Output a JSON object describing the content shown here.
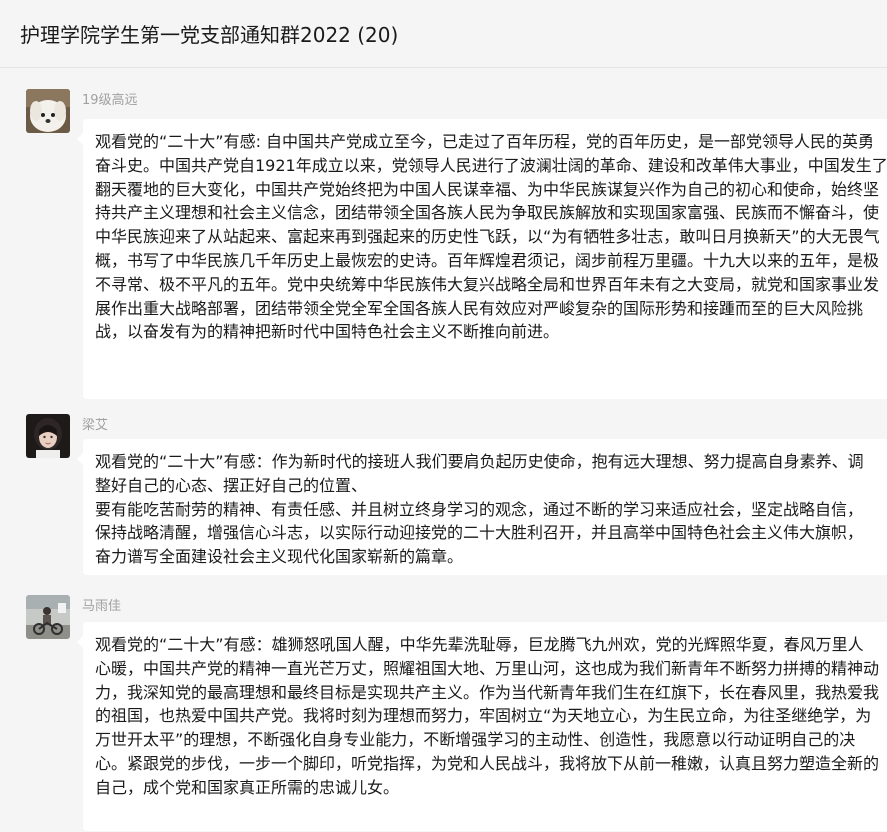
{
  "header": {
    "title": "护理学院学生第一党支部通知群2022 (20)"
  },
  "messages": [
    {
      "sender": "19级高远",
      "avatar": "white-dog-avatar",
      "text": "观看党的“二十大”有感: 自中国共产党成立至今，已走过了百年历程，党的百年历史，是一部党领导人民的英勇奋斗史。中国共产党自1921年成立以来，党领导人民进行了波澜壮阔的革命、建设和改革伟大事业，中国发生了翻天覆地的巨大变化，中国共产党始终把为中国人民谋幸福、为中华民族谋复兴作为自己的初心和使命，始终坚持共产主义理想和社会主义信念，团结带领全国各族人民为争取民族解放和实现国家富强、民族而不懈奋斗，使中华民族迎来了从站起来、富起来再到强起来的历史性飞跃，以“为有牺牲多壮志，敢叫日月换新天”的大无畏气概，书写了中华民族几千年历史上最恢宏的史诗。百年辉煌君须记，阔步前程万里疆。十九大以来的五年，是极不寻常、极不平凡的五年。党中央统筹中华民族伟大复兴战略全局和世界百年未有之大变局，就党和国家事业发展作出重大战略部署，团结带领全党全军全国各族人民有效应对严峻复杂的国际形势和接踵而至的巨大风险挑战，以奋发有为的精神把新时代中国特色社会主义不断推向前进。"
    },
    {
      "sender": "梁艾",
      "avatar": "girl-portrait-avatar",
      "text": "观看党的“二十大”有感：作为新时代的接班人我们要肩负起历史使命，抱有远大理想、努力提高自身素养、调整好自己的心态、摆正好自己的位置、\n要有能吃苦耐劳的精神、有责任感、并且树立终身学习的观念，通过不断的学习来适应社会，坚定战略自信，保持战略清醒，增强信心斗志，以实际行动迎接党的二十大胜利召开，并且高举中国特色社会主义伟大旗帜，奋力谱写全面建设社会主义现代化国家崭新的篇章。"
    },
    {
      "sender": "马雨佳",
      "avatar": "person-riding-avatar",
      "text": "观看党的“二十大”有感：雄狮怒吼国人醒，中华先辈洗耻辱，巨龙腾飞九州欢，党的光辉照华夏，春风万里人心暖，中国共产党的精神一直光芒万丈，照耀祖国大地、万里山河，这也成为我们新青年不断努力拼搏的精神动力，我深知党的最高理想和最终目标是实现共产主义。作为当代新青年我们生在红旗下，长在春风里，我热爱我的祖国，也热爱中国共产党。我将时刻为理想而努力，牢固树立“为天地立心，为生民立命，为往圣继绝学，为万世开太平”的理想，不断强化自身专业能力，不断增强学习的主动性、创造性，我愿意以行动证明自己的决心。紧跟党的步伐，一步一个脚印，听党指挥，为党和人民战斗，我将放下从前一稚嫩，认真且努力塑造全新的自己，成个党和国家真正所需的忠诚儿女。"
    }
  ]
}
